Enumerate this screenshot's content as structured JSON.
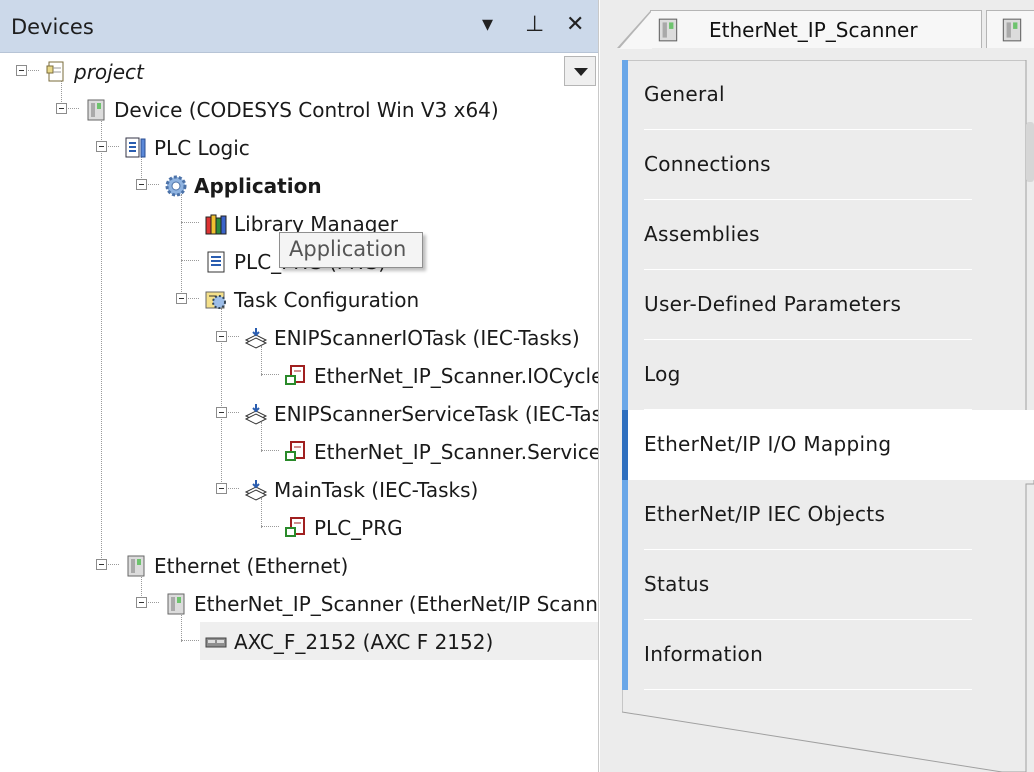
{
  "devices_pane": {
    "title": "Devices",
    "buttons": [
      "▾",
      "⊥",
      "✕"
    ]
  },
  "tree": [
    {
      "label": "project",
      "icon": "project-icon",
      "italic": true
    },
    {
      "label": "Device (CODESYS Control Win V3 x64)",
      "icon": "device-icon"
    },
    {
      "label": "PLC Logic",
      "icon": "plc-logic-icon"
    },
    {
      "label": "Application",
      "icon": "application-gear-icon",
      "bold": true
    },
    {
      "label": "Library Manager",
      "icon": "library-manager-icon"
    },
    {
      "label": "PLC_PRG (PRG)",
      "icon": "pou-document-icon"
    },
    {
      "label": "Task Configuration",
      "icon": "task-configuration-icon"
    },
    {
      "label": "ENIPScannerIOTask (IEC-Tasks)",
      "icon": "task-icon"
    },
    {
      "label": "EtherNet_IP_Scanner.IOCycle",
      "icon": "program-call-icon"
    },
    {
      "label": "ENIPScannerServiceTask (IEC-Tasks)",
      "icon": "task-icon"
    },
    {
      "label": "EtherNet_IP_Scanner.ServiceCycle",
      "icon": "program-call-icon"
    },
    {
      "label": "MainTask (IEC-Tasks)",
      "icon": "task-icon"
    },
    {
      "label": "PLC_PRG",
      "icon": "program-call-icon"
    },
    {
      "label": "Ethernet (Ethernet)",
      "icon": "device-icon"
    },
    {
      "label": "EtherNet_IP_Scanner (EtherNet/IP Scanner)",
      "icon": "device-icon"
    },
    {
      "label": "AXC_F_2152 (AXC F 2152)",
      "icon": "adapter-module-icon"
    }
  ],
  "tooltip": "Application",
  "editor": {
    "tab_title": "EtherNet_IP_Scanner",
    "nav_items": [
      {
        "label": "General",
        "active": false
      },
      {
        "label": "Connections",
        "active": false
      },
      {
        "label": "Assemblies",
        "active": false
      },
      {
        "label": "User-Defined Parameters",
        "active": false
      },
      {
        "label": "Log",
        "active": false
      },
      {
        "label": "EtherNet/IP I/O Mapping",
        "active": true
      },
      {
        "label": "EtherNet/IP IEC Objects",
        "active": false
      },
      {
        "label": "Status",
        "active": false
      },
      {
        "label": "Information",
        "active": false
      }
    ]
  },
  "colors": {
    "header_bg": "#ccd9ea",
    "nav_accent": "#6aa7e8",
    "nav_accent_active": "#2f6fbf",
    "editor_bg": "#ececec"
  }
}
